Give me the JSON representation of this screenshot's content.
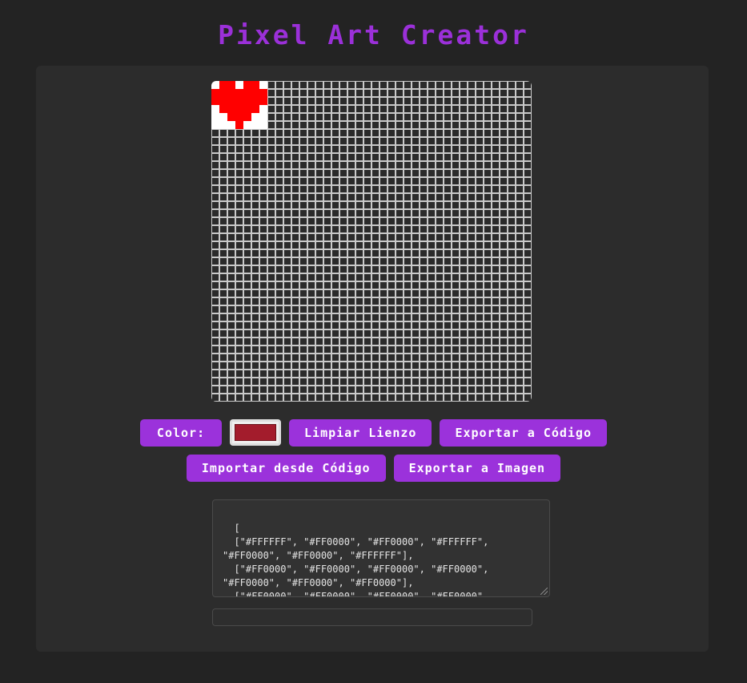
{
  "app": {
    "title": "Pixel Art Creator"
  },
  "colors": {
    "accent": "#9b32db",
    "title": "#9b30d9",
    "background": "#232323",
    "panel": "#2c2c2c",
    "grid_line": "#c9c9c9",
    "selected_color": "#a31c2c"
  },
  "canvas": {
    "columns": 40,
    "rows": 40,
    "empty_color": "#2b2b2b",
    "pixels": [
      [
        "#FFFFFF",
        "#FF0000",
        "#FF0000",
        "#FFFFFF",
        "#FF0000",
        "#FF0000",
        "#FFFFFF"
      ],
      [
        "#FF0000",
        "#FF0000",
        "#FF0000",
        "#FF0000",
        "#FF0000",
        "#FF0000",
        "#FF0000"
      ],
      [
        "#FF0000",
        "#FF0000",
        "#FF0000",
        "#FF0000",
        "#FF0000",
        "#FF0000",
        "#FF0000"
      ],
      [
        "#FFFFFF",
        "#FF0000",
        "#FF0000",
        "#FF0000",
        "#FF0000",
        "#FF0000",
        "#FFFFFF"
      ],
      [
        "#FFFFFF",
        "#FFFFFF",
        "#FF0000",
        "#FF0000",
        "#FF0000",
        "#FFFFFF",
        "#FFFFFF"
      ],
      [
        "#FFFFFF",
        "#FFFFFF",
        "#FFFFFF",
        "#FF0000",
        "#FFFFFF",
        "#FFFFFF",
        "#FFFFFF"
      ]
    ]
  },
  "controls": {
    "color_label": "Color:",
    "clear_label": "Limpiar Lienzo",
    "export_code_label": "Exportar a Código",
    "import_code_label": "Importar desde Código",
    "export_image_label": "Exportar a Imagen"
  },
  "code_output": {
    "text": "[\n  [\"#FFFFFF\", \"#FF0000\", \"#FF0000\", \"#FFFFFF\", \"#FF0000\", \"#FF0000\", \"#FFFFFF\"],\n  [\"#FF0000\", \"#FF0000\", \"#FF0000\", \"#FF0000\", \"#FF0000\", \"#FF0000\", \"#FF0000\"],\n  [\"#FF0000\", \"#FF0000\", \"#FF0000\", \"#FF0000\", \"#FF0000\", \"#FF0000\", \"#FF0000\"],"
  },
  "import_field": {
    "value": ""
  }
}
